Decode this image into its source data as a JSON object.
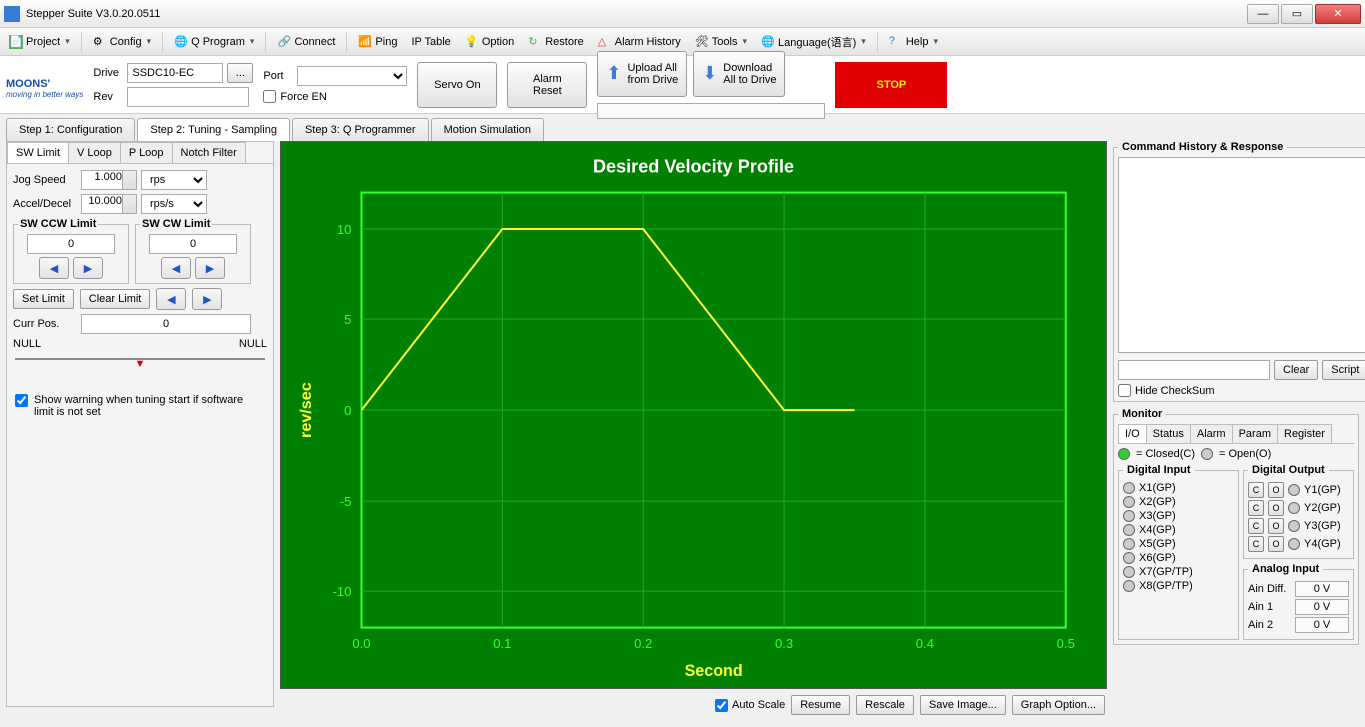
{
  "window": {
    "title": "Stepper Suite V3.0.20.0511"
  },
  "menu": {
    "project": "Project",
    "config": "Config",
    "qprogram": "Q Program",
    "connect": "Connect",
    "ping": "Ping",
    "iptable": "IP Table",
    "option": "Option",
    "restore": "Restore",
    "alarm": "Alarm History",
    "tools": "Tools",
    "language": "Language(语言)",
    "help": "Help"
  },
  "top": {
    "logo": "MOONS'",
    "logosub": "moving in better ways",
    "drive_lbl": "Drive",
    "drive": "SSDC10-EC",
    "rev_lbl": "Rev",
    "rev": "",
    "port_lbl": "Port",
    "port": "",
    "servo": "Servo On",
    "alarmreset": "Alarm\nReset",
    "upload1": "Upload All",
    "upload2": "from Drive",
    "download1": "Download",
    "download2": "All to Drive",
    "stop": "STOP",
    "forceen": "Force EN"
  },
  "steps": {
    "s1": "Step 1: Configuration",
    "s2": "Step 2: Tuning - Sampling",
    "s3": "Step 3: Q Programmer",
    "s4": "Motion Simulation"
  },
  "sub": {
    "sw": "SW Limit",
    "v": "V Loop",
    "p": "P Loop",
    "n": "Notch Filter"
  },
  "jog": {
    "jsl": "Jog Speed",
    "js": "1.000",
    "jsu": "rps",
    "adl": "Accel/Decel",
    "ad": "10.000",
    "adu": "rps/s",
    "ccw": "SW CCW Limit",
    "ccwv": "0",
    "cw": "SW CW Limit",
    "cwv": "0",
    "setlimit": "Set Limit",
    "clearlimit": "Clear Limit",
    "curpos": "Curr Pos.",
    "curposv": "0",
    "null1": "NULL",
    "null2": "NULL",
    "warn": "Show warning when tuning start if software limit is not set"
  },
  "chart_data": {
    "type": "line",
    "title": "Desired Velocity Profile",
    "xlabel": "Second",
    "ylabel": "rev/sec",
    "xlim": [
      0,
      0.5
    ],
    "ylim": [
      -12,
      12
    ],
    "xticks": [
      0.0,
      0.1,
      0.2,
      0.3,
      0.4,
      0.5
    ],
    "yticks": [
      -10,
      -5,
      0,
      5,
      10
    ],
    "x": [
      0.0,
      0.1,
      0.2,
      0.3,
      0.35
    ],
    "y": [
      0,
      10,
      10,
      0,
      0
    ]
  },
  "chartctl": {
    "autoscale": "Auto Scale",
    "resume": "Resume",
    "rescale": "Rescale",
    "save": "Save Image...",
    "graph": "Graph Option..."
  },
  "hist": {
    "title": "Command History & Response",
    "clear": "Clear",
    "script": "Script",
    "hide": "Hide CheckSum"
  },
  "monitor": {
    "title": "Monitor",
    "tabs": {
      "io": "I/O",
      "status": "Status",
      "alarm": "Alarm",
      "param": "Param",
      "register": "Register"
    },
    "closed": "= Closed(C)",
    "open": "= Open(O)",
    "di": "Digital Input",
    "do": "Digital Output",
    "ai": "Analog Input",
    "dis": [
      "X1(GP)",
      "X2(GP)",
      "X3(GP)",
      "X4(GP)",
      "X5(GP)",
      "X6(GP)",
      "X7(GP/TP)",
      "X8(GP/TP)"
    ],
    "dos": [
      "Y1(GP)",
      "Y2(GP)",
      "Y3(GP)",
      "Y4(GP)"
    ],
    "aindiff": "Ain Diff.",
    "ain1": "Ain 1",
    "ain2": "Ain 2",
    "zv": "0 V"
  }
}
